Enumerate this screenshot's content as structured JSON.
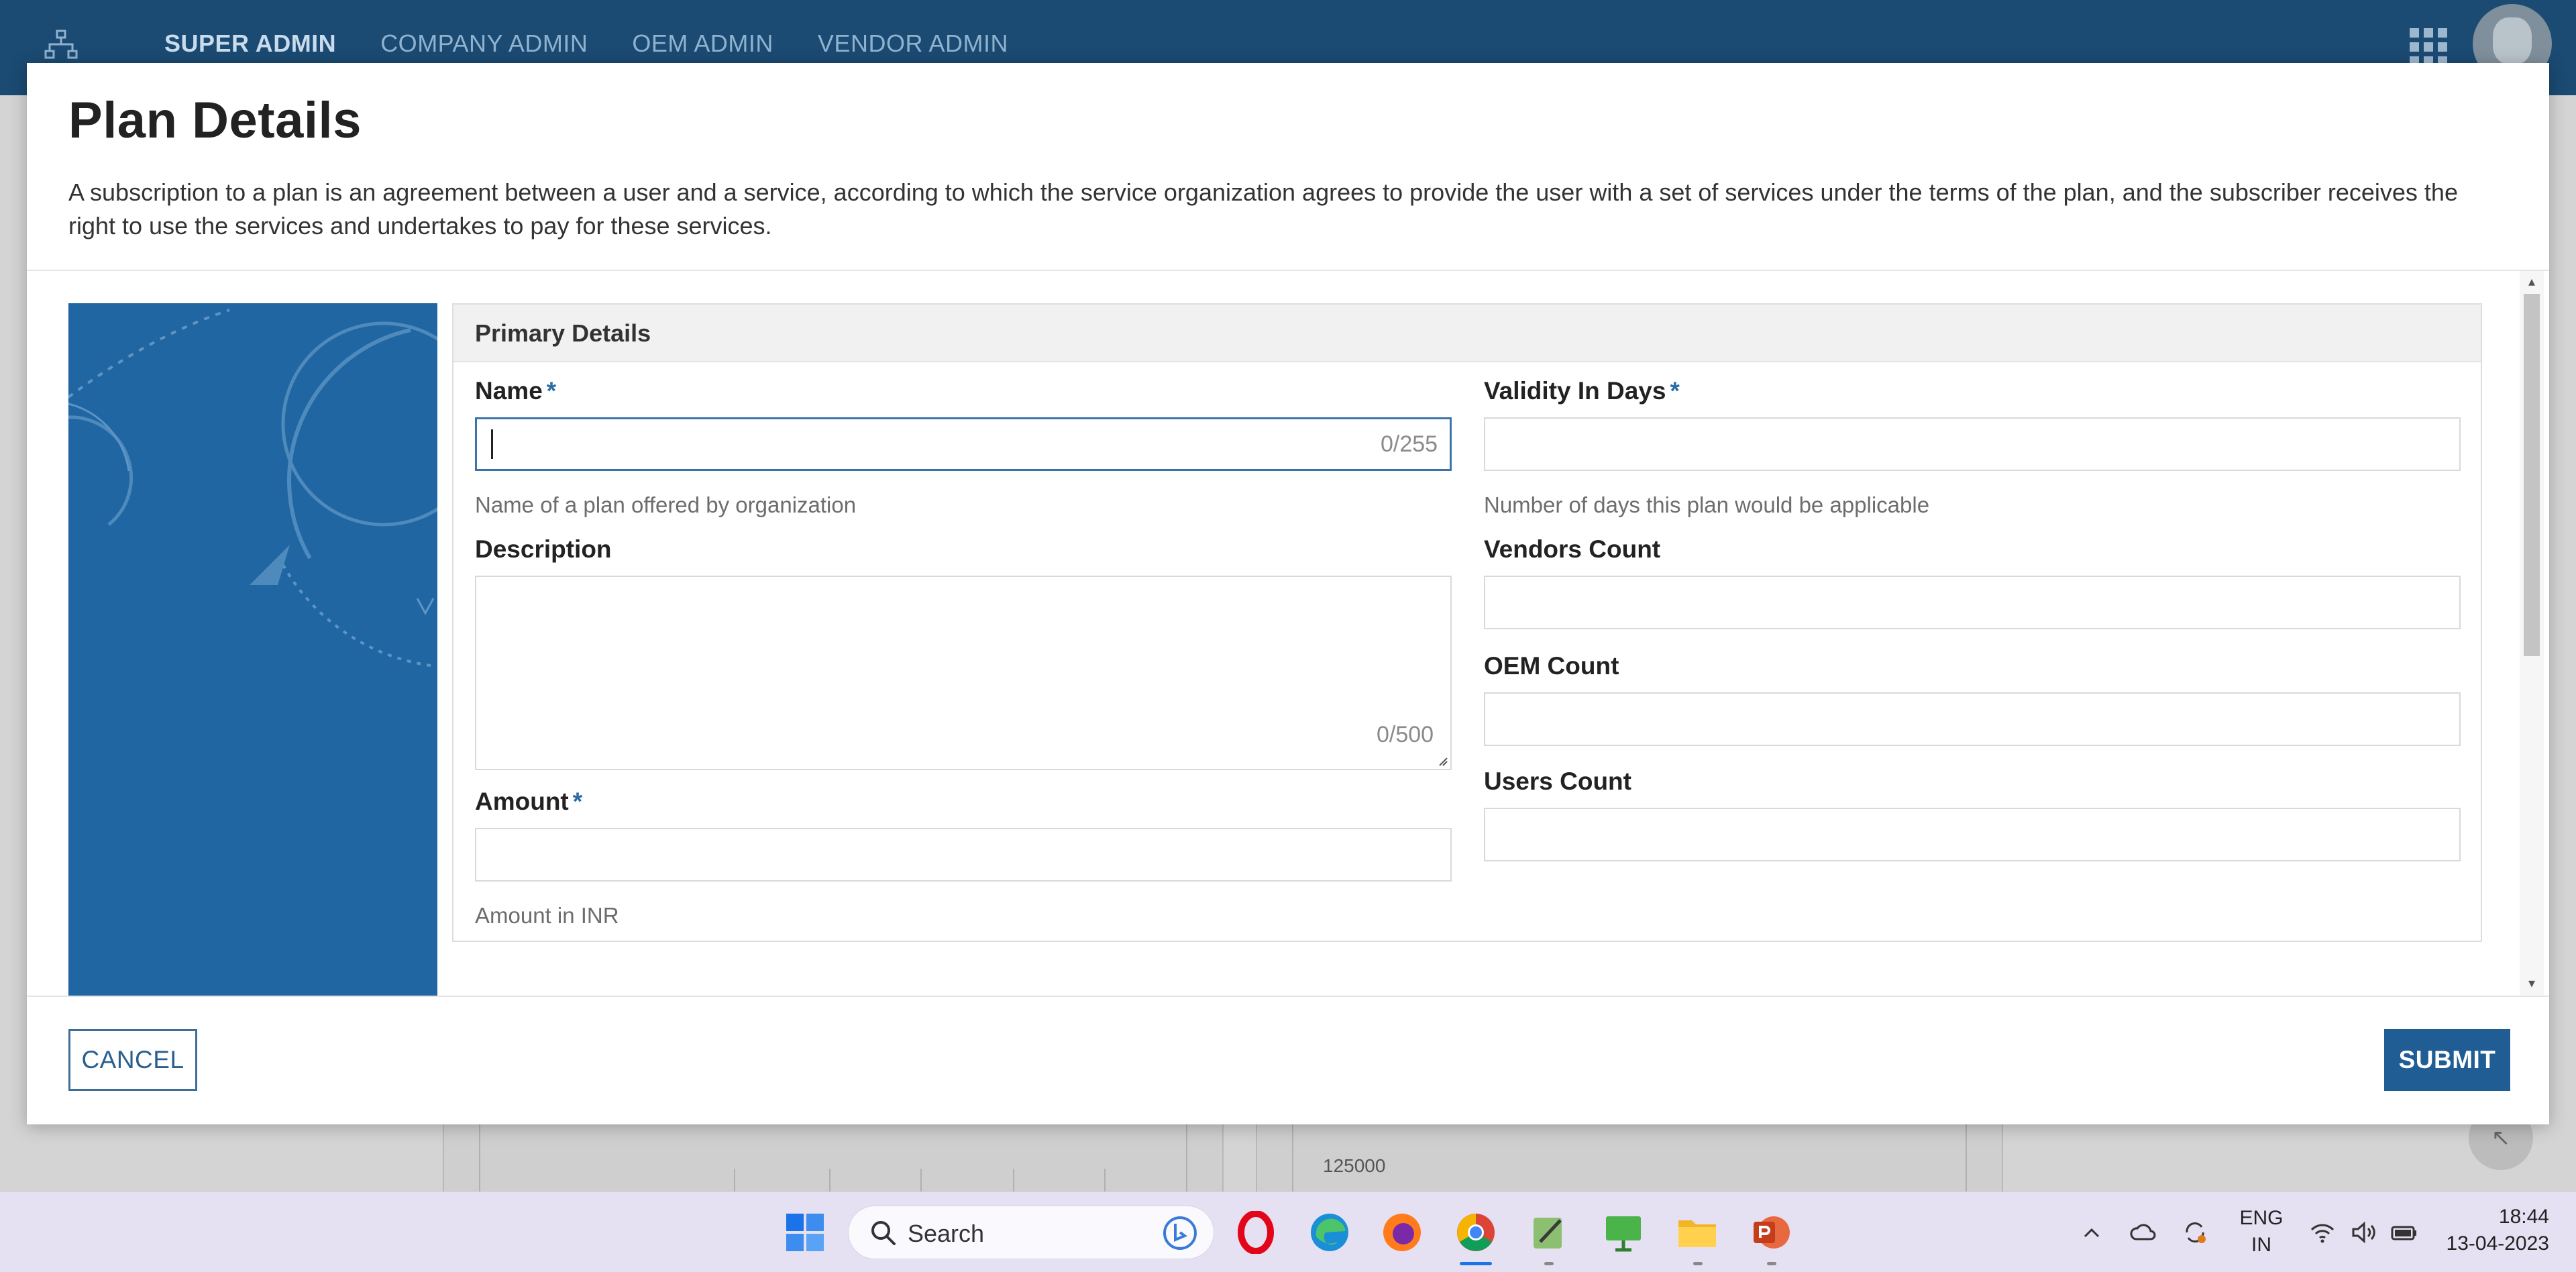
{
  "app_bar": {
    "nav": [
      "SUPER ADMIN",
      "COMPANY ADMIN",
      "OEM ADMIN",
      "VENDOR ADMIN"
    ],
    "active_nav": "SUPER ADMIN"
  },
  "background": {
    "axis_label": "125000"
  },
  "modal": {
    "title": "Plan Details",
    "description": "A subscription to a plan is an agreement between a user and a service, according to which the service organization agrees to provide the user with a set of services under the terms of the plan, and the subscriber receives the right to use the services and undertakes to pay for these services.",
    "section_title": "Primary Details",
    "fields": {
      "name": {
        "label": "Name",
        "required_mark": "*",
        "value": "",
        "counter": "0/255",
        "helper": "Name of a plan offered by organization"
      },
      "description": {
        "label": "Description",
        "counter": "0/500"
      },
      "amount": {
        "label": "Amount",
        "required_mark": "*",
        "helper": "Amount in INR"
      },
      "validity": {
        "label": "Validity In Days",
        "required_mark": "*",
        "helper": "Number of days this plan would be applicable"
      },
      "vendors_count": {
        "label": "Vendors Count"
      },
      "oem_count": {
        "label": "OEM Count"
      },
      "users_count": {
        "label": "Users Count"
      }
    },
    "buttons": {
      "cancel": "CANCEL",
      "submit": "SUBMIT"
    }
  },
  "taskbar": {
    "search_label": "Search",
    "lang_top": "ENG",
    "lang_bottom": "IN",
    "time": "18:44",
    "date": "13-04-2023",
    "apps": [
      "start-icon",
      "opera-icon",
      "edge-icon",
      "firefox-icon",
      "chrome-icon",
      "notepad-icon",
      "presentation-icon",
      "file-explorer-icon",
      "powerpoint-icon"
    ]
  },
  "colors": {
    "app_bar": "#1b4a72",
    "accent": "#1f5d94",
    "side_art": "#1f66a3",
    "required": "#2b6aa6"
  }
}
